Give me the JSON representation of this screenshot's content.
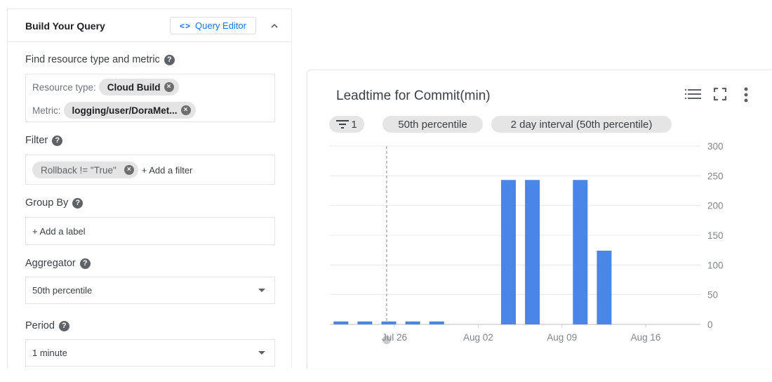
{
  "query_panel": {
    "title": "Build Your Query",
    "query_editor_label": "Query Editor",
    "resource_section": {
      "label": "Find resource type and metric",
      "resource_type_label": "Resource type:",
      "resource_type_value": "Cloud Build",
      "metric_label": "Metric:",
      "metric_value": "logging/user/DoraMet..."
    },
    "filter": {
      "label": "Filter",
      "chip": "Rollback != \"True\"",
      "add_label": "+ Add a filter"
    },
    "group_by": {
      "label": "Group By",
      "add_label": "+ Add a label"
    },
    "aggregator": {
      "label": "Aggregator",
      "value": "50th percentile"
    },
    "period": {
      "label": "Period",
      "value": "1 minute"
    }
  },
  "chart_panel": {
    "title": "Leadtime for Commit(min)",
    "pills": {
      "filter_count": "1",
      "aggregator": "50th percentile",
      "interval": "2 day interval (50th percentile)"
    },
    "colors": {
      "bar": "#4a86e8",
      "grid": "#e8e8e8",
      "axis_text": "#80868b"
    }
  },
  "chart_data": {
    "type": "bar",
    "title": "Leadtime for Commit(min)",
    "xlabel": "",
    "ylabel": "",
    "interval_days": 2,
    "x_ticks": [
      "Jul 26",
      "Aug 02",
      "Aug 09",
      "Aug 16"
    ],
    "y_ticks": [
      0,
      50,
      100,
      150,
      200,
      250,
      300
    ],
    "ylim": [
      0,
      300
    ],
    "x_range": [
      "Jul 21",
      "Aug 21"
    ],
    "grid": true,
    "y_axis_side": "right",
    "cursor_date": "Jul 25",
    "bars": [
      {
        "date": "Jul 22",
        "value": 5
      },
      {
        "date": "Jul 24",
        "value": 5
      },
      {
        "date": "Jul 26",
        "value": 5
      },
      {
        "date": "Jul 28",
        "value": 5
      },
      {
        "date": "Jul 30",
        "value": 5
      },
      {
        "date": "Aug 05",
        "value": 243
      },
      {
        "date": "Aug 07",
        "value": 243
      },
      {
        "date": "Aug 11",
        "value": 243
      },
      {
        "date": "Aug 13",
        "value": 124
      }
    ]
  }
}
